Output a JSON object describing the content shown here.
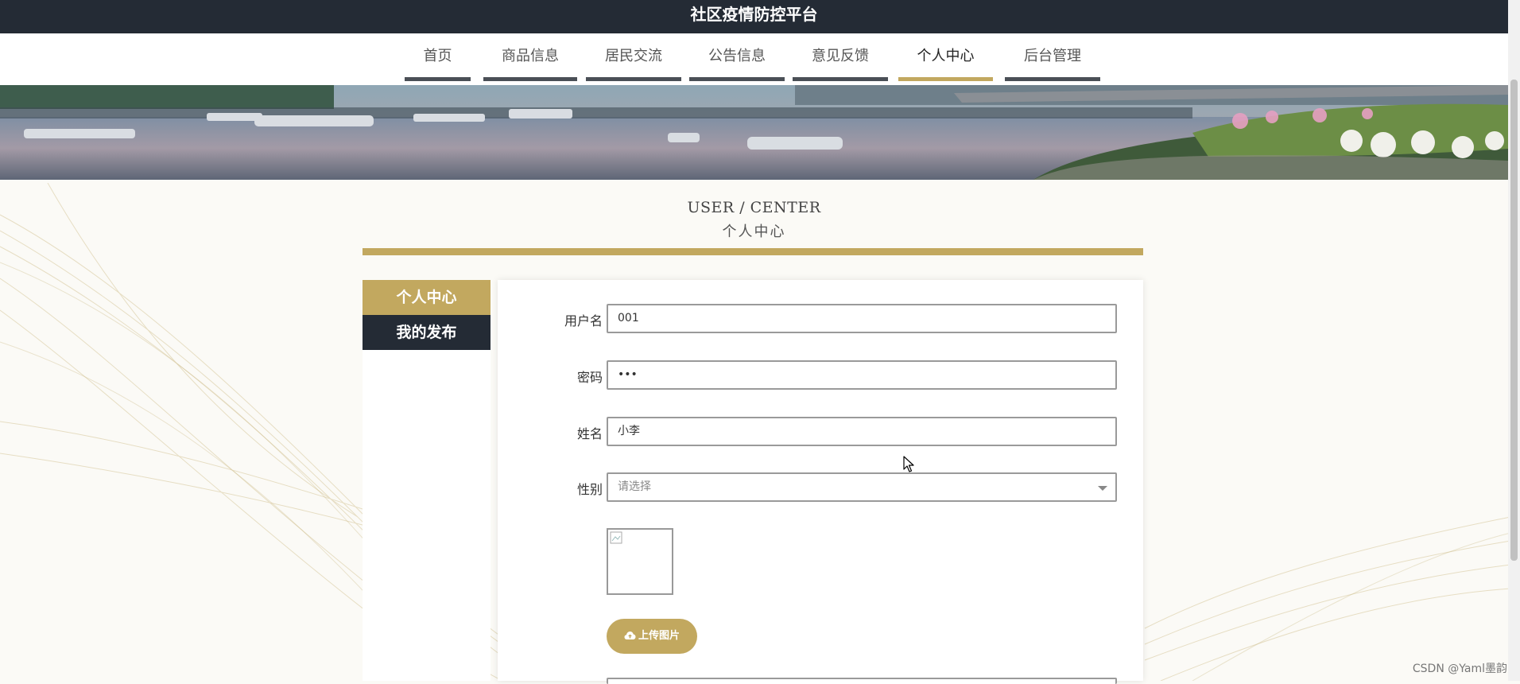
{
  "topbar": {
    "title": "社区疫情防控平台"
  },
  "nav": {
    "items": [
      {
        "label": "首页"
      },
      {
        "label": "商品信息"
      },
      {
        "label": "居民交流"
      },
      {
        "label": "公告信息"
      },
      {
        "label": "意见反馈"
      },
      {
        "label": "个人中心",
        "active": true
      },
      {
        "label": "后台管理"
      }
    ]
  },
  "section": {
    "title_en": "USER / CENTER",
    "title_cn": "个人中心"
  },
  "sidebar": {
    "tabs": [
      {
        "label": "个人中心",
        "active": true
      },
      {
        "label": "我的发布"
      }
    ]
  },
  "form": {
    "username": {
      "label": "用户名",
      "value": "001"
    },
    "password": {
      "label": "密码",
      "value": "•••"
    },
    "name": {
      "label": "姓名",
      "value": "小李"
    },
    "gender": {
      "label": "性别",
      "placeholder": "请选择"
    },
    "upload": {
      "label": "上传图片",
      "icon": "cloud-upload-icon"
    }
  },
  "watermark": "CSDN @Yaml墨韵",
  "colors": {
    "accent": "#c2a85f",
    "dark": "#242b35"
  }
}
